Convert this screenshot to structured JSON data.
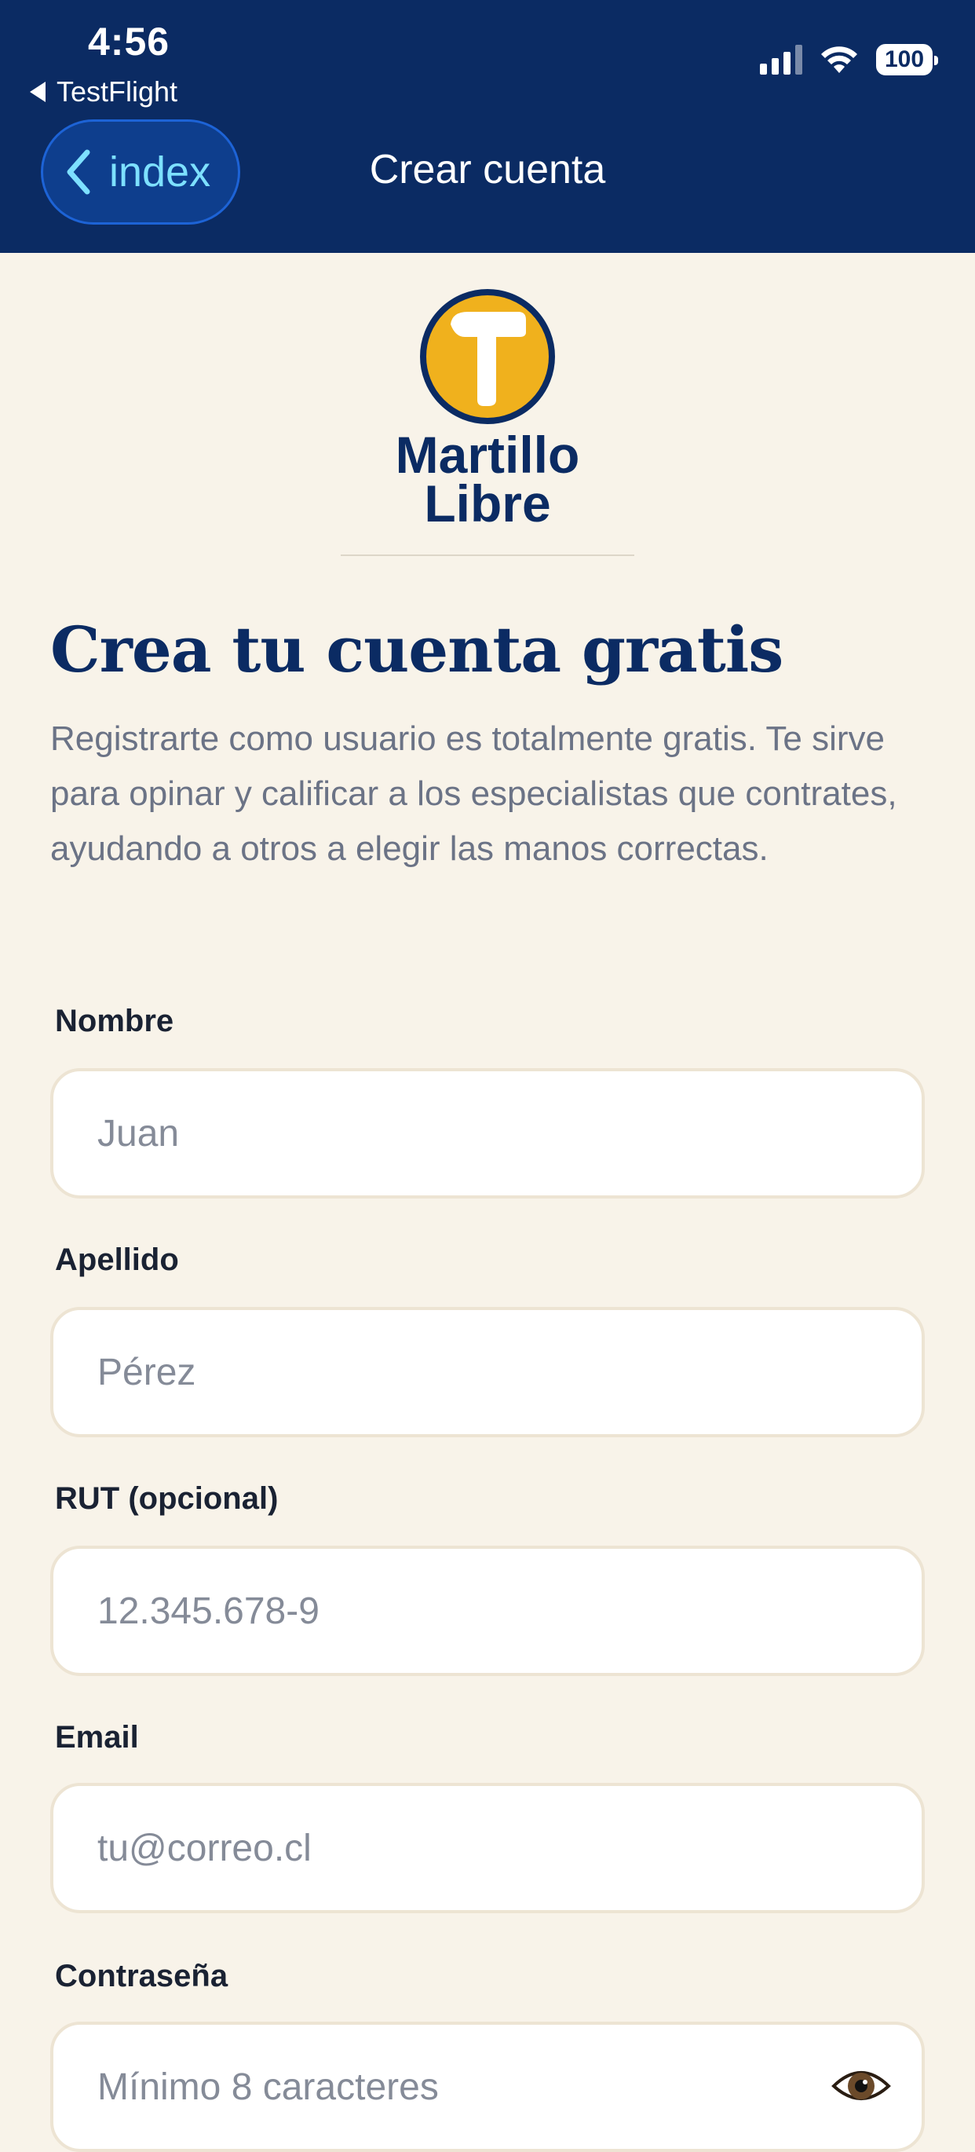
{
  "status_bar": {
    "time": "4:56",
    "back_app": "TestFlight",
    "battery": "100"
  },
  "nav": {
    "back_label": "index",
    "title": "Crear cuenta"
  },
  "logo": {
    "line1": "Martillo",
    "line2": "Libre"
  },
  "heading": "Crea tu cuenta gratis",
  "description": "Registrarte como usuario es totalmente gratis. Te sirve para opinar y calificar a los especialistas que contrates, ayudando a otros a elegir las manos correctas.",
  "form": {
    "nombre_label": "Nombre",
    "nombre_placeholder": "Juan",
    "apellido_label": "Apellido",
    "apellido_placeholder": "Pérez",
    "rut_label": "RUT (opcional)",
    "rut_placeholder": "12.345.678-9",
    "email_label": "Email",
    "email_placeholder": "tu@correo.cl",
    "password_label": "Contraseña",
    "password_placeholder": "Mínimo 8 caracteres"
  },
  "colors": {
    "primary": "#0B2B63",
    "accent": "#F0B11D",
    "background": "#F8F3E9",
    "back_button_text": "#7DE0FF"
  }
}
